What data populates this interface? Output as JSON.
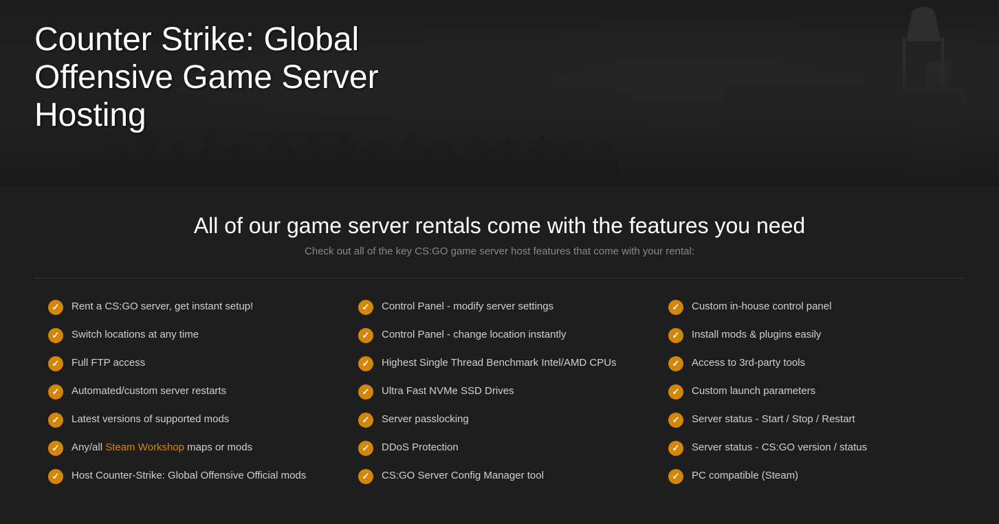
{
  "hero": {
    "title": "Counter Strike: Global Offensive Game Server Hosting"
  },
  "features": {
    "header": {
      "title": "All of our game server rentals come with the features you need",
      "subtitle": "Check out all of the key CS:GO game server host features that come with your rental:"
    },
    "columns": [
      {
        "items": [
          {
            "text": "Rent a CS:GO server, get instant setup!",
            "hasLink": false
          },
          {
            "text": "Switch locations at any time",
            "hasLink": false
          },
          {
            "text": "Full FTP access",
            "hasLink": false
          },
          {
            "text": "Automated/custom server restarts",
            "hasLink": false
          },
          {
            "text": "Latest versions of supported mods",
            "hasLink": false
          },
          {
            "text": "Any/all Steam Workshop maps or mods",
            "hasLink": true,
            "linkText": "Steam Workshop",
            "beforeLink": "Any/all ",
            "afterLink": " maps or mods"
          },
          {
            "text": "Host Counter-Strike: Global Offensive Official mods",
            "hasLink": false
          }
        ]
      },
      {
        "items": [
          {
            "text": "Control Panel - modify server settings",
            "hasLink": false
          },
          {
            "text": "Control Panel - change location instantly",
            "hasLink": false
          },
          {
            "text": "Highest Single Thread Benchmark Intel/AMD CPUs",
            "hasLink": false
          },
          {
            "text": "Ultra Fast NVMe SSD Drives",
            "hasLink": false
          },
          {
            "text": "Server passlocking",
            "hasLink": false
          },
          {
            "text": "DDoS Protection",
            "hasLink": false
          },
          {
            "text": "CS:GO Server Config Manager tool",
            "hasLink": false
          }
        ]
      },
      {
        "items": [
          {
            "text": "Custom in-house control panel",
            "hasLink": false
          },
          {
            "text": "Install mods & plugins easily",
            "hasLink": false
          },
          {
            "text": "Access to 3rd-party tools",
            "hasLink": false
          },
          {
            "text": "Custom launch parameters",
            "hasLink": false
          },
          {
            "text": "Server status - Start / Stop / Restart",
            "hasLink": false
          },
          {
            "text": "Server status - CS:GO version / status",
            "hasLink": false
          },
          {
            "text": "PC compatible (Steam)",
            "hasLink": false
          }
        ]
      }
    ]
  }
}
